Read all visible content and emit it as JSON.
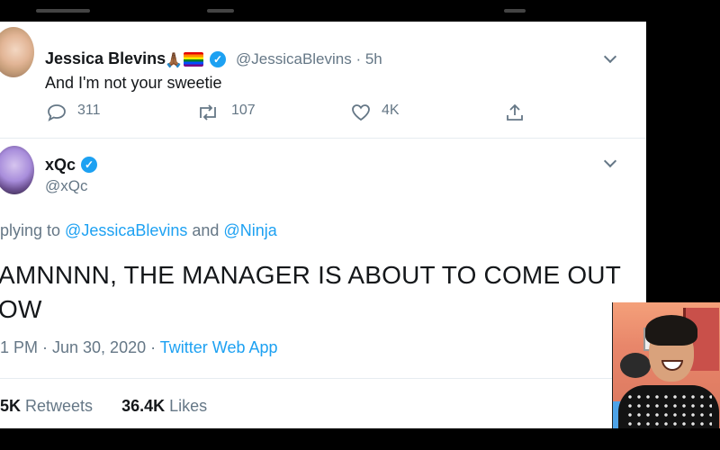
{
  "tweet_reply": {
    "name": "Jessica Blevins",
    "emoji": "🙏🏾",
    "handle_time": "@JessicaBlevins · 5h",
    "text": "And I'm not your sweetie",
    "replies": "311",
    "retweets": "107",
    "likes": "4K"
  },
  "main_tweet": {
    "name": "xQc",
    "handle": "@xQc",
    "replying_prefix": "plying to ",
    "mention1": "@JessicaBlevins",
    "and_word": " and ",
    "mention2": "@Ninja",
    "body": "AMNNNN, THE MANAGER IS ABOUT TO COME OUT\nOW",
    "timestamp": "1 PM · Jun 30, 2020 · ",
    "source": "Twitter Web App",
    "retweet_count": "5K",
    "retweet_label": " Retweets",
    "like_count": "36.4K",
    "like_label": " Likes"
  },
  "icons": {
    "verified": "verified-badge-icon",
    "more": "chevron-down-icon",
    "reply": "reply-icon",
    "retweet": "retweet-icon",
    "like": "heart-icon",
    "share": "share-icon"
  },
  "colors": {
    "link": "#1da1f2",
    "secondary": "#657786",
    "text": "#14171a"
  }
}
